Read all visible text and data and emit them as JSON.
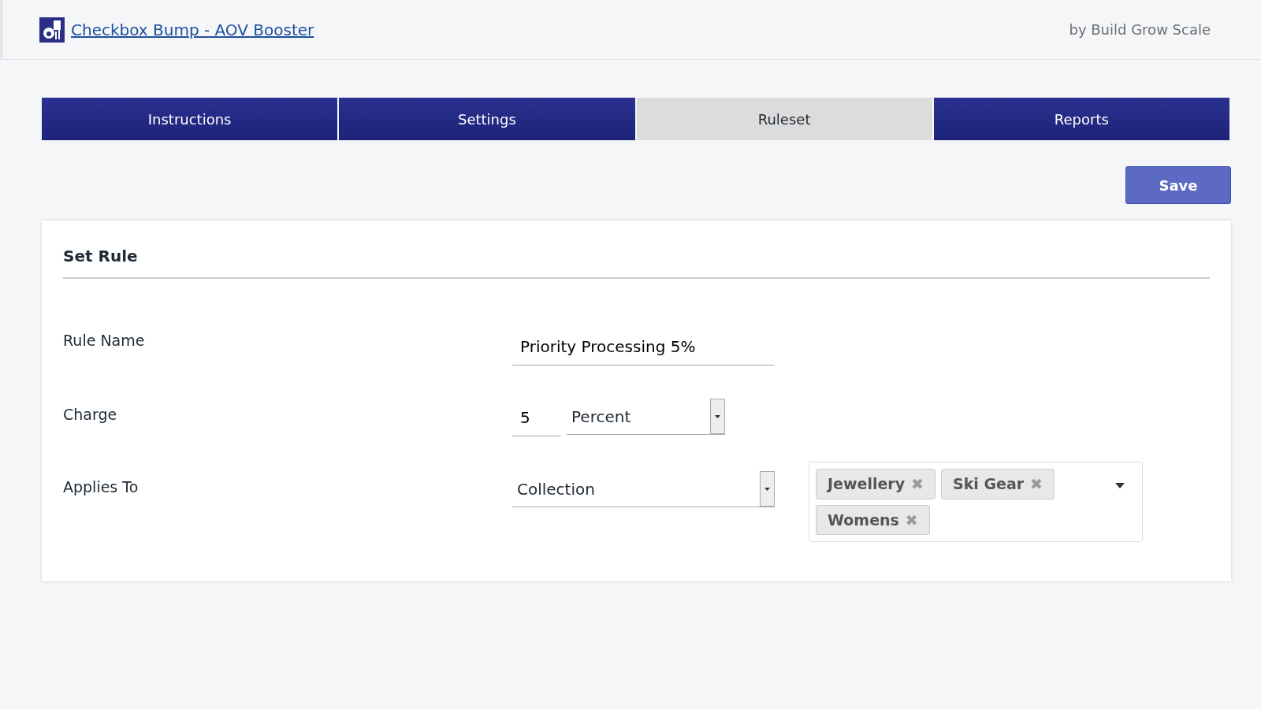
{
  "header": {
    "app_title": "Checkbox Bump - AOV Booster",
    "vendor": "by Build Grow Scale"
  },
  "tabs": [
    {
      "label": "Instructions",
      "selected": false
    },
    {
      "label": "Settings",
      "selected": false
    },
    {
      "label": "Ruleset",
      "selected": true
    },
    {
      "label": "Reports",
      "selected": false
    }
  ],
  "save_button": "Save",
  "card": {
    "title": "Set Rule",
    "rule_name": {
      "label": "Rule Name",
      "value": "Priority Processing 5%"
    },
    "charge": {
      "label": "Charge",
      "amount": "5",
      "unit": "Percent"
    },
    "applies_to": {
      "label": "Applies To",
      "type": "Collection",
      "tags": [
        {
          "label": "Jewellery",
          "remove": "✖"
        },
        {
          "label": "Ski Gear",
          "remove": "✖"
        },
        {
          "label": "Womens",
          "remove": "✖"
        }
      ]
    }
  }
}
